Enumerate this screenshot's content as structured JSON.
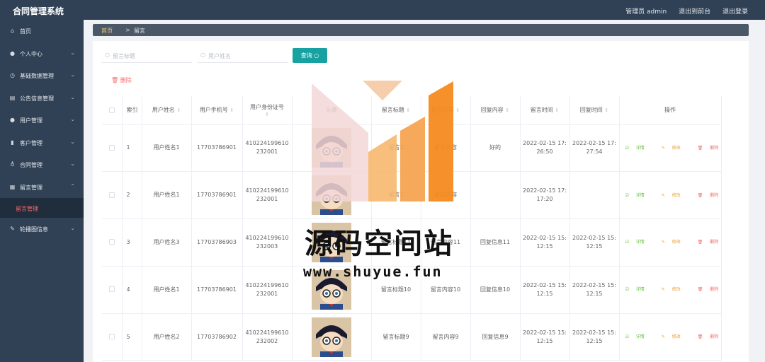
{
  "app": {
    "title": "合同管理系统"
  },
  "header": {
    "admin": "管理员 admin",
    "to_front": "退出到前台",
    "logout": "退出登录"
  },
  "sidebar": {
    "items": [
      {
        "label": "首页",
        "icon": "home-icon",
        "arrow": ""
      },
      {
        "label": "个人中心",
        "icon": "user-icon",
        "arrow": "⌄"
      },
      {
        "label": "基础数据管理",
        "icon": "clock-icon",
        "arrow": "⌄"
      },
      {
        "label": "公告信息管理",
        "icon": "database-icon",
        "arrow": "⌄"
      },
      {
        "label": "用户管理",
        "icon": "user-icon",
        "arrow": "⌄"
      },
      {
        "label": "客户管理",
        "icon": "bar-chart-icon",
        "arrow": "⌄"
      },
      {
        "label": "合同管理",
        "icon": "mic-icon",
        "arrow": "⌄"
      },
      {
        "label": "留言管理",
        "icon": "calendar-icon",
        "arrow": "⌃"
      }
    ],
    "sub_item": "留言管理",
    "last_item": {
      "label": "轮播图信息",
      "icon": "edit-icon",
      "arrow": "⌄"
    }
  },
  "breadcrumb": {
    "home": "首页",
    "sep": ">",
    "current": "留言"
  },
  "search": {
    "title_placeholder": "留言标题",
    "user_placeholder": "用户姓名",
    "query_label": "查询"
  },
  "toolbar": {
    "delete_label": "删除"
  },
  "table": {
    "columns": [
      "索引",
      "用户姓名",
      "用户手机号",
      "用户身份证号",
      "头像",
      "留言标题",
      "留言内容",
      "回复内容",
      "留言时间",
      "回复时间",
      "操作"
    ],
    "ops": {
      "detail": "详情",
      "edit": "修改",
      "delete": "删除"
    },
    "rows": [
      {
        "idx": "1",
        "name": "用户姓名1",
        "phone": "17703786901",
        "id_a": "410224199610",
        "id_b": "232001",
        "title": "留言1",
        "content": "留言内容",
        "reply": "好的",
        "time_a": "2022-02-15 17:",
        "time_b": "26:50",
        "rtime_a": "2022-02-15 17:",
        "rtime_b": "27:54"
      },
      {
        "idx": "2",
        "name": "用户姓名1",
        "phone": "17703786901",
        "id_a": "410224199610",
        "id_b": "232001",
        "title": "留言1",
        "content": "留言内容",
        "reply": "",
        "time_a": "2022-02-15 17:",
        "time_b": "17:20",
        "rtime_a": "",
        "rtime_b": ""
      },
      {
        "idx": "3",
        "name": "用户姓名3",
        "phone": "17703786903",
        "id_a": "410224199610",
        "id_b": "232003",
        "title": "留言标题11",
        "content": "留言内容11",
        "reply": "回复信息11",
        "time_a": "2022-02-15 15:",
        "time_b": "12:15",
        "rtime_a": "2022-02-15 15:",
        "rtime_b": "12:15"
      },
      {
        "idx": "4",
        "name": "用户姓名1",
        "phone": "17703786901",
        "id_a": "410224199610",
        "id_b": "232001",
        "title": "留言标题10",
        "content": "留言内容10",
        "reply": "回复信息10",
        "time_a": "2022-02-15 15:",
        "time_b": "12:15",
        "rtime_a": "2022-02-15 15:",
        "rtime_b": "12:15"
      },
      {
        "idx": "5",
        "name": "用户姓名2",
        "phone": "17703786902",
        "id_a": "410224199610",
        "id_b": "232002",
        "title": "留言标题9",
        "content": "留言内容9",
        "reply": "回复信息9",
        "time_a": "2022-02-15 15:",
        "time_b": "12:15",
        "rtime_a": "2022-02-15 15:",
        "rtime_b": "12:15"
      }
    ]
  },
  "watermark": {
    "title": "源码空间站",
    "url": "www.shuyue.fun"
  },
  "colors": {
    "sidebar": "#304156",
    "accent": "#17a2a1",
    "danger": "#f56c6c",
    "warning": "#e6a23c",
    "success": "#67c23a"
  }
}
